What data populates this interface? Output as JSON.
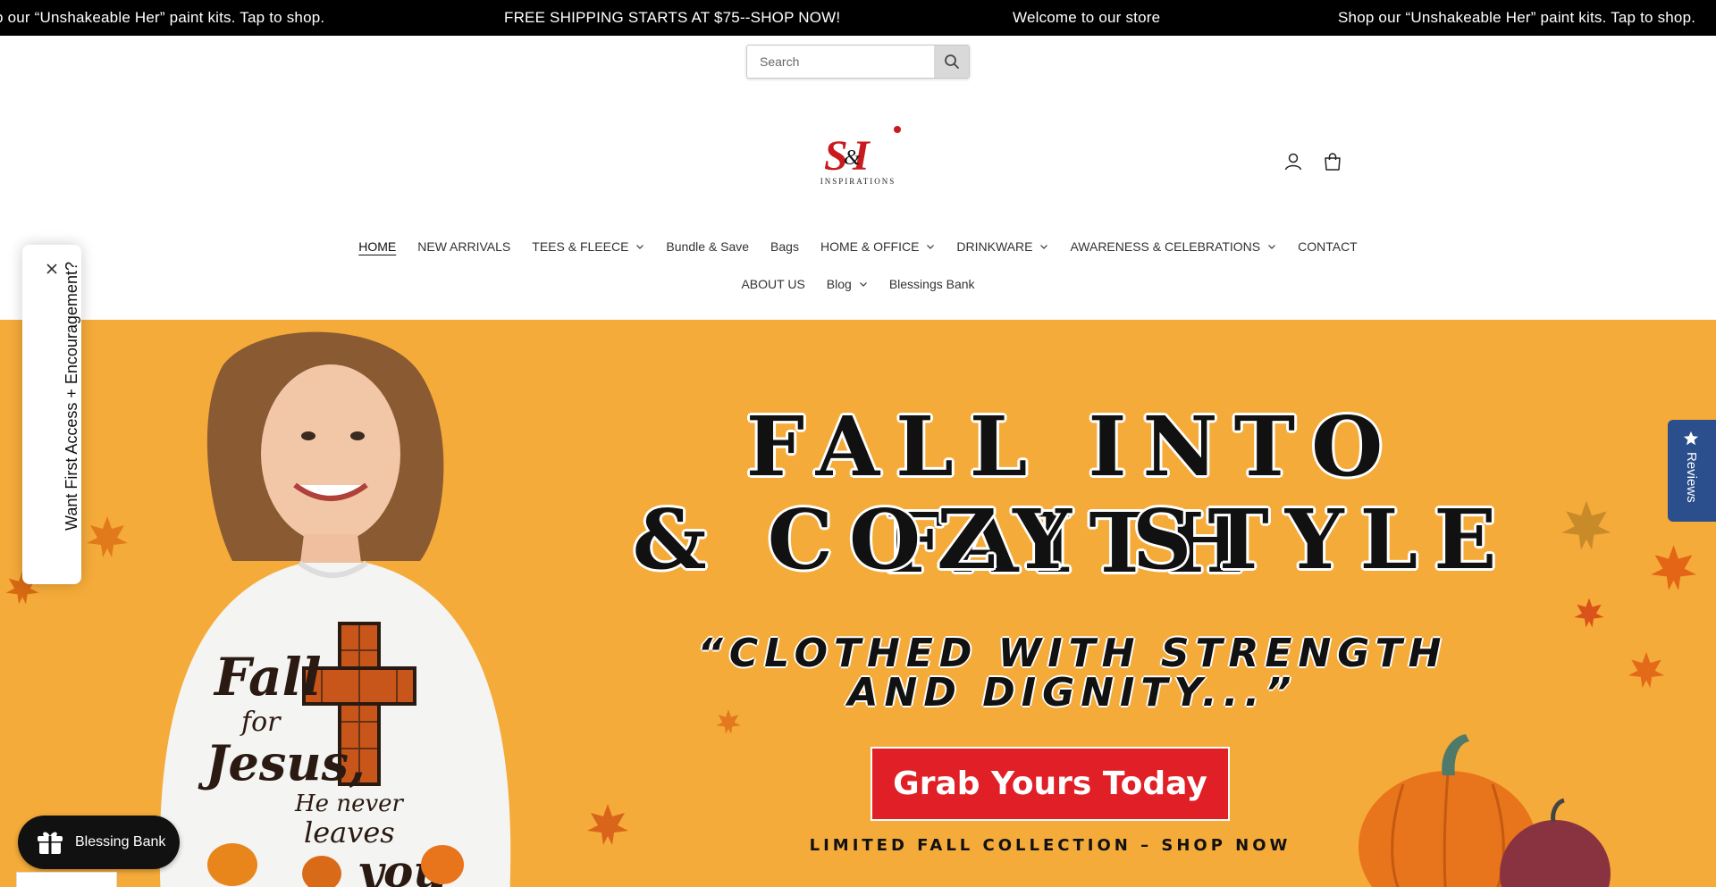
{
  "announcement": {
    "items": [
      "p our “Unshakeable Her” paint kits. Tap to shop.",
      "FREE SHIPPING STARTS AT $75--SHOP NOW!",
      "Welcome to our store",
      "Shop our “Unshakeable Her” paint kits. Tap to shop."
    ]
  },
  "search": {
    "placeholder": "Search",
    "icon": "search-icon"
  },
  "logo": {
    "mark": "S&I",
    "sub": "INSPIRATIONS"
  },
  "header_icons": [
    "account-icon",
    "cart-icon"
  ],
  "nav": {
    "row1": [
      {
        "label": "HOME",
        "active": true,
        "dropdown": false
      },
      {
        "label": "NEW ARRIVALS",
        "dropdown": false
      },
      {
        "label": "TEES & FLEECE",
        "dropdown": true
      },
      {
        "label": "Bundle & Save",
        "dropdown": false
      },
      {
        "label": "Bags",
        "dropdown": false
      },
      {
        "label": "HOME & OFFICE",
        "dropdown": true
      },
      {
        "label": "DRINKWARE",
        "dropdown": true
      },
      {
        "label": "AWARENESS & CELEBRATIONS",
        "dropdown": true
      },
      {
        "label": "CONTACT",
        "dropdown": false
      }
    ],
    "row2": [
      {
        "label": "ABOUT US",
        "dropdown": false
      },
      {
        "label": "Blog",
        "dropdown": true
      },
      {
        "label": "Blessings Bank",
        "dropdown": false
      }
    ]
  },
  "hero": {
    "headline_1": "FALL INTO FAITH",
    "headline_2": "& COZY STYLE",
    "quote_1": "“CLOTHED WITH STRENGTH",
    "quote_2": "AND DIGNITY...”",
    "cta": "Grab Yours Today",
    "subline": "LIMITED FALL COLLECTION – SHOP NOW",
    "shirt_text": [
      "Fall",
      "for",
      "Jesus,",
      "He never",
      "leaves",
      "you"
    ],
    "background": "#f5ab39",
    "cta_color": "#e01f26"
  },
  "popup": {
    "text": "Want First Access + Encouragement?",
    "close_icon": "close-icon"
  },
  "reviews": {
    "label": "Reviews",
    "icon": "star-icon"
  },
  "blessing_bank": {
    "label": "Blessing Bank",
    "icon": "gift-icon"
  }
}
